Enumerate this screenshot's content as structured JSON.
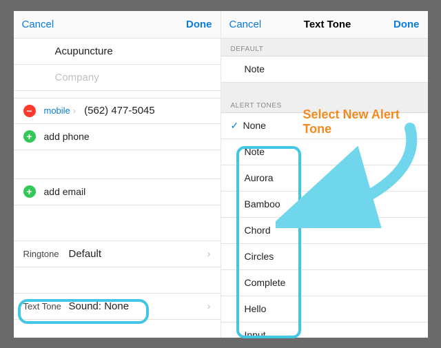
{
  "left": {
    "nav": {
      "cancel": "Cancel",
      "done": "Done"
    },
    "name": "Acupuncture",
    "company_placeholder": "Company",
    "phone": {
      "label": "mobile",
      "value": "(562) 477-5045"
    },
    "add_phone": "add phone",
    "add_email": "add email",
    "ringtone": {
      "label": "Ringtone",
      "value": "Default"
    },
    "texttone": {
      "label": "Text Tone",
      "value": "Sound: None"
    }
  },
  "right": {
    "nav": {
      "cancel": "Cancel",
      "title": "Text Tone",
      "done": "Done"
    },
    "default_header": "DEFAULT",
    "default_value": "Note",
    "alert_header": "ALERT TONES",
    "selected": "None",
    "tones": [
      "Note",
      "Aurora",
      "Bamboo",
      "Chord",
      "Circles",
      "Complete",
      "Hello",
      "Input"
    ]
  },
  "annotation": {
    "callout": "Select New Alert Tone"
  }
}
